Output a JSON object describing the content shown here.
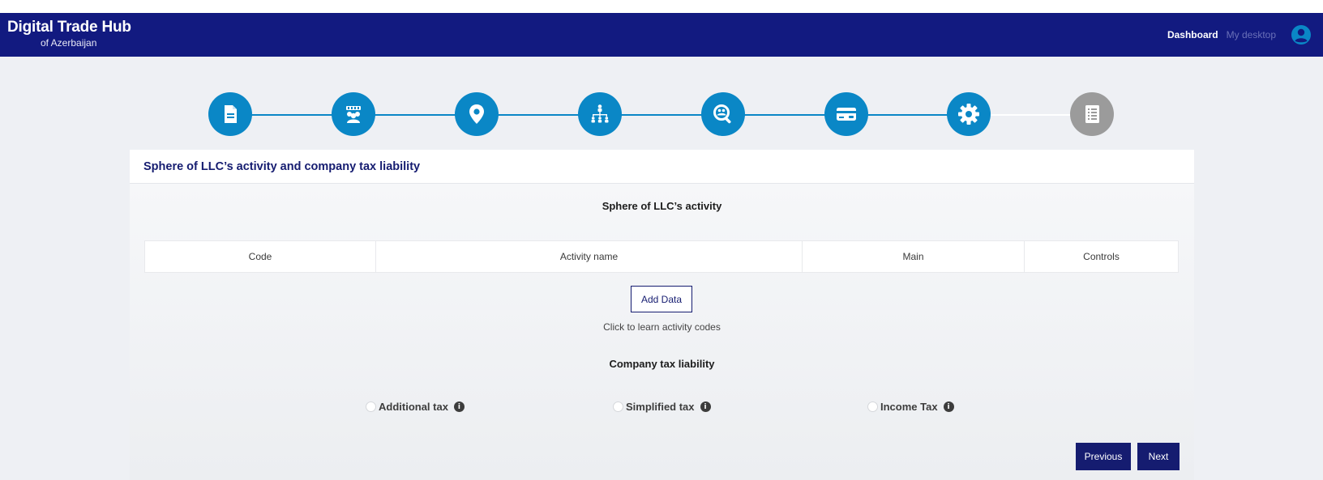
{
  "header": {
    "brand_title": "Digital Trade Hub",
    "brand_subtitle": "of Azerbaijan",
    "nav_dashboard": "Dashboard",
    "nav_my_desktop": "My desktop",
    "user_icon": "user-circle-icon",
    "bar_color": "#121a80"
  },
  "stepper": {
    "active_color": "#0a87c6",
    "inactive_color": "#9b9b9b",
    "steps": [
      {
        "icon": "document-icon",
        "state": "completed"
      },
      {
        "icon": "group-people-icon",
        "state": "completed"
      },
      {
        "icon": "location-pin-icon",
        "state": "completed"
      },
      {
        "icon": "org-structure-icon",
        "state": "completed"
      },
      {
        "icon": "search-people-icon",
        "state": "completed"
      },
      {
        "icon": "credit-card-icon",
        "state": "completed"
      },
      {
        "icon": "gear-icon",
        "state": "active"
      },
      {
        "icon": "document-list-icon",
        "state": "inactive"
      }
    ]
  },
  "card": {
    "title": "Sphere of LLC’s activity and company tax liability",
    "activity_section_title": "Sphere of LLC’s activity",
    "table_columns": [
      "Code",
      "Activity name",
      "Main",
      "Controls"
    ],
    "add_button": "Add Data",
    "learn_codes_link": "Click to learn activity codes",
    "tax_section_title": "Company tax liability",
    "tax_options": [
      {
        "label": "Additional tax",
        "selected": false
      },
      {
        "label": "Simplified tax",
        "selected": false
      },
      {
        "label": "Income Tax",
        "selected": false
      }
    ],
    "previous_button": "Previous",
    "next_button": "Next"
  }
}
